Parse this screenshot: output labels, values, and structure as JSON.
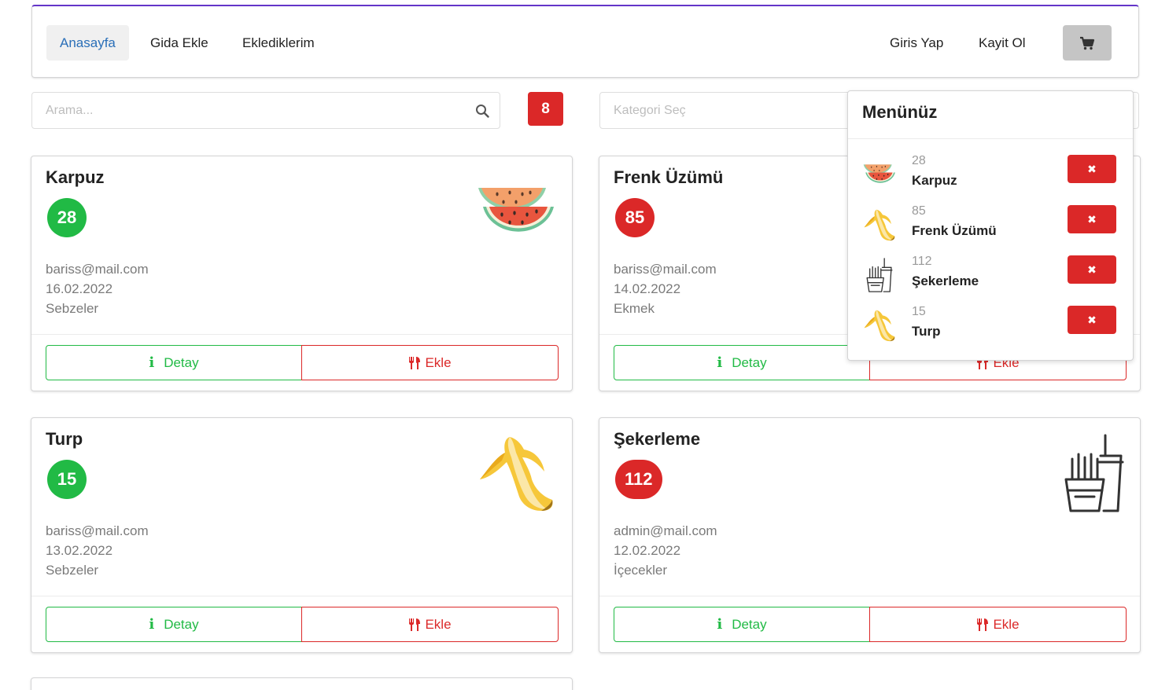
{
  "navbar": {
    "items": [
      {
        "label": "Anasayfa",
        "active": true
      },
      {
        "label": "Gida Ekle",
        "active": false
      },
      {
        "label": "Eklediklerim",
        "active": false
      }
    ],
    "right_items": [
      {
        "label": "Giris Yap"
      },
      {
        "label": "Kayit Ol"
      }
    ],
    "cart_icon": "cart-icon"
  },
  "search": {
    "placeholder": "Arama...",
    "icon": "search-icon"
  },
  "count_badge": "8",
  "category": {
    "placeholder": "Kategori Seç"
  },
  "cards": [
    {
      "title": "Karpuz",
      "calories": "28",
      "calorie_color": "green",
      "email": "bariss@mail.com",
      "date": "16.02.2022",
      "category": "Sebzeler",
      "image": "watermelon-icon",
      "detay_label": "Detay",
      "ekle_label": "Ekle"
    },
    {
      "title": "Frenk Üzümü",
      "calories": "85",
      "calorie_color": "red",
      "email": "bariss@mail.com",
      "date": "14.02.2022",
      "category": "Ekmek",
      "image": "banana-icon",
      "detay_label": "Detay",
      "ekle_label": "Ekle"
    },
    {
      "title": "Turp",
      "calories": "15",
      "calorie_color": "green",
      "email": "bariss@mail.com",
      "date": "13.02.2022",
      "category": "Sebzeler",
      "image": "banana-icon",
      "detay_label": "Detay",
      "ekle_label": "Ekle"
    },
    {
      "title": "Şekerleme",
      "calories": "112",
      "calorie_color": "red",
      "email": "admin@mail.com",
      "date": "12.02.2022",
      "category": "İçecekler",
      "image": "fries-drink-icon",
      "detay_label": "Detay",
      "ekle_label": "Ekle"
    }
  ],
  "menu": {
    "title": "Menünüz",
    "items": [
      {
        "calories": "28",
        "name": "Karpuz",
        "image": "watermelon-icon"
      },
      {
        "calories": "85",
        "name": "Frenk Üzümü",
        "image": "banana-icon"
      },
      {
        "calories": "112",
        "name": "Şekerleme",
        "image": "fries-drink-icon"
      },
      {
        "calories": "15",
        "name": "Turp",
        "image": "banana-icon"
      }
    ]
  },
  "colors": {
    "accent": "#6435c9",
    "green": "#21ba45",
    "red": "#db2828",
    "active_link": "#2a6fb8"
  }
}
